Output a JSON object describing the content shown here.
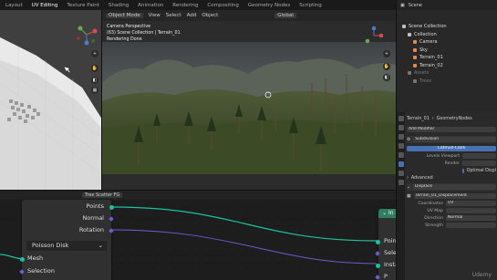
{
  "topbar": {
    "tabs": [
      "Layout",
      "UV Editing",
      "Texture Paint",
      "Shading",
      "Animation",
      "Rendering",
      "Compositing",
      "Geometry Nodes",
      "Scripting"
    ]
  },
  "viewport_header": {
    "mode": "Object Mode",
    "menu_view": "View",
    "menu_select": "Select",
    "menu_add": "Add",
    "menu_object": "Object",
    "orientation": "Global"
  },
  "camera_overlay": {
    "line1": "Camera Perspective",
    "line2": "(63) Scene Collection | Terrain_01",
    "line3": "Rendering Done"
  },
  "outliner": {
    "scene_label": "Scene",
    "items": [
      {
        "label": "Scene Collection",
        "dim": false,
        "color": "#bdbdbd"
      },
      {
        "label": "Collection",
        "dim": false,
        "color": "#bdbdbd"
      },
      {
        "label": "Camera",
        "dim": false,
        "color": "#e8893a"
      },
      {
        "label": "Sky",
        "dim": false,
        "color": "#e8893a"
      },
      {
        "label": "Terrain_01",
        "dim": false,
        "color": "#e8893a"
      },
      {
        "label": "Terrain_02",
        "dim": false,
        "color": "#e8893a"
      },
      {
        "label": "Assets",
        "dim": true,
        "color": "#777777"
      },
      {
        "label": "Trees",
        "dim": true,
        "color": "#777777"
      }
    ]
  },
  "properties": {
    "object_name": "Terrain_01",
    "node_group": "GeometryNodes",
    "add_modifier": "Add Modifier",
    "subdivision": "Subdivision",
    "catmull_clark": "Catmull-Clark",
    "levels_viewport_label": "Levels Viewport",
    "render_label": "Render",
    "optimal_display": "Optimal Displ",
    "advanced": "Advanced",
    "displace": "Displace",
    "texture": "Terrain_01_Displacement",
    "coordinates_label": "Coordinates",
    "coordinates_value": "UV",
    "uv_map_label": "UV Map",
    "direction_label": "Direction",
    "direction_value": "Normal",
    "strength_label": "Strength"
  },
  "node_editor": {
    "header_tag": "Tree Scatter FG",
    "left_node": {
      "outputs": [
        "Points",
        "Normal",
        "Rotation"
      ],
      "dropdown": "Poisson Disk",
      "inputs": [
        "Mesh",
        "Selection"
      ]
    },
    "right_node": {
      "title_abbrev": "In",
      "inputs": [
        "Points",
        "Select",
        "Insta"
      ],
      "last_partial": "P"
    },
    "watermark": "Udemy"
  },
  "colors": {
    "accent_blue": "#4772b3",
    "socket_green": "#19c3a0",
    "socket_purple": "#6b5bd1",
    "node_header_green": "#2f7f62"
  }
}
